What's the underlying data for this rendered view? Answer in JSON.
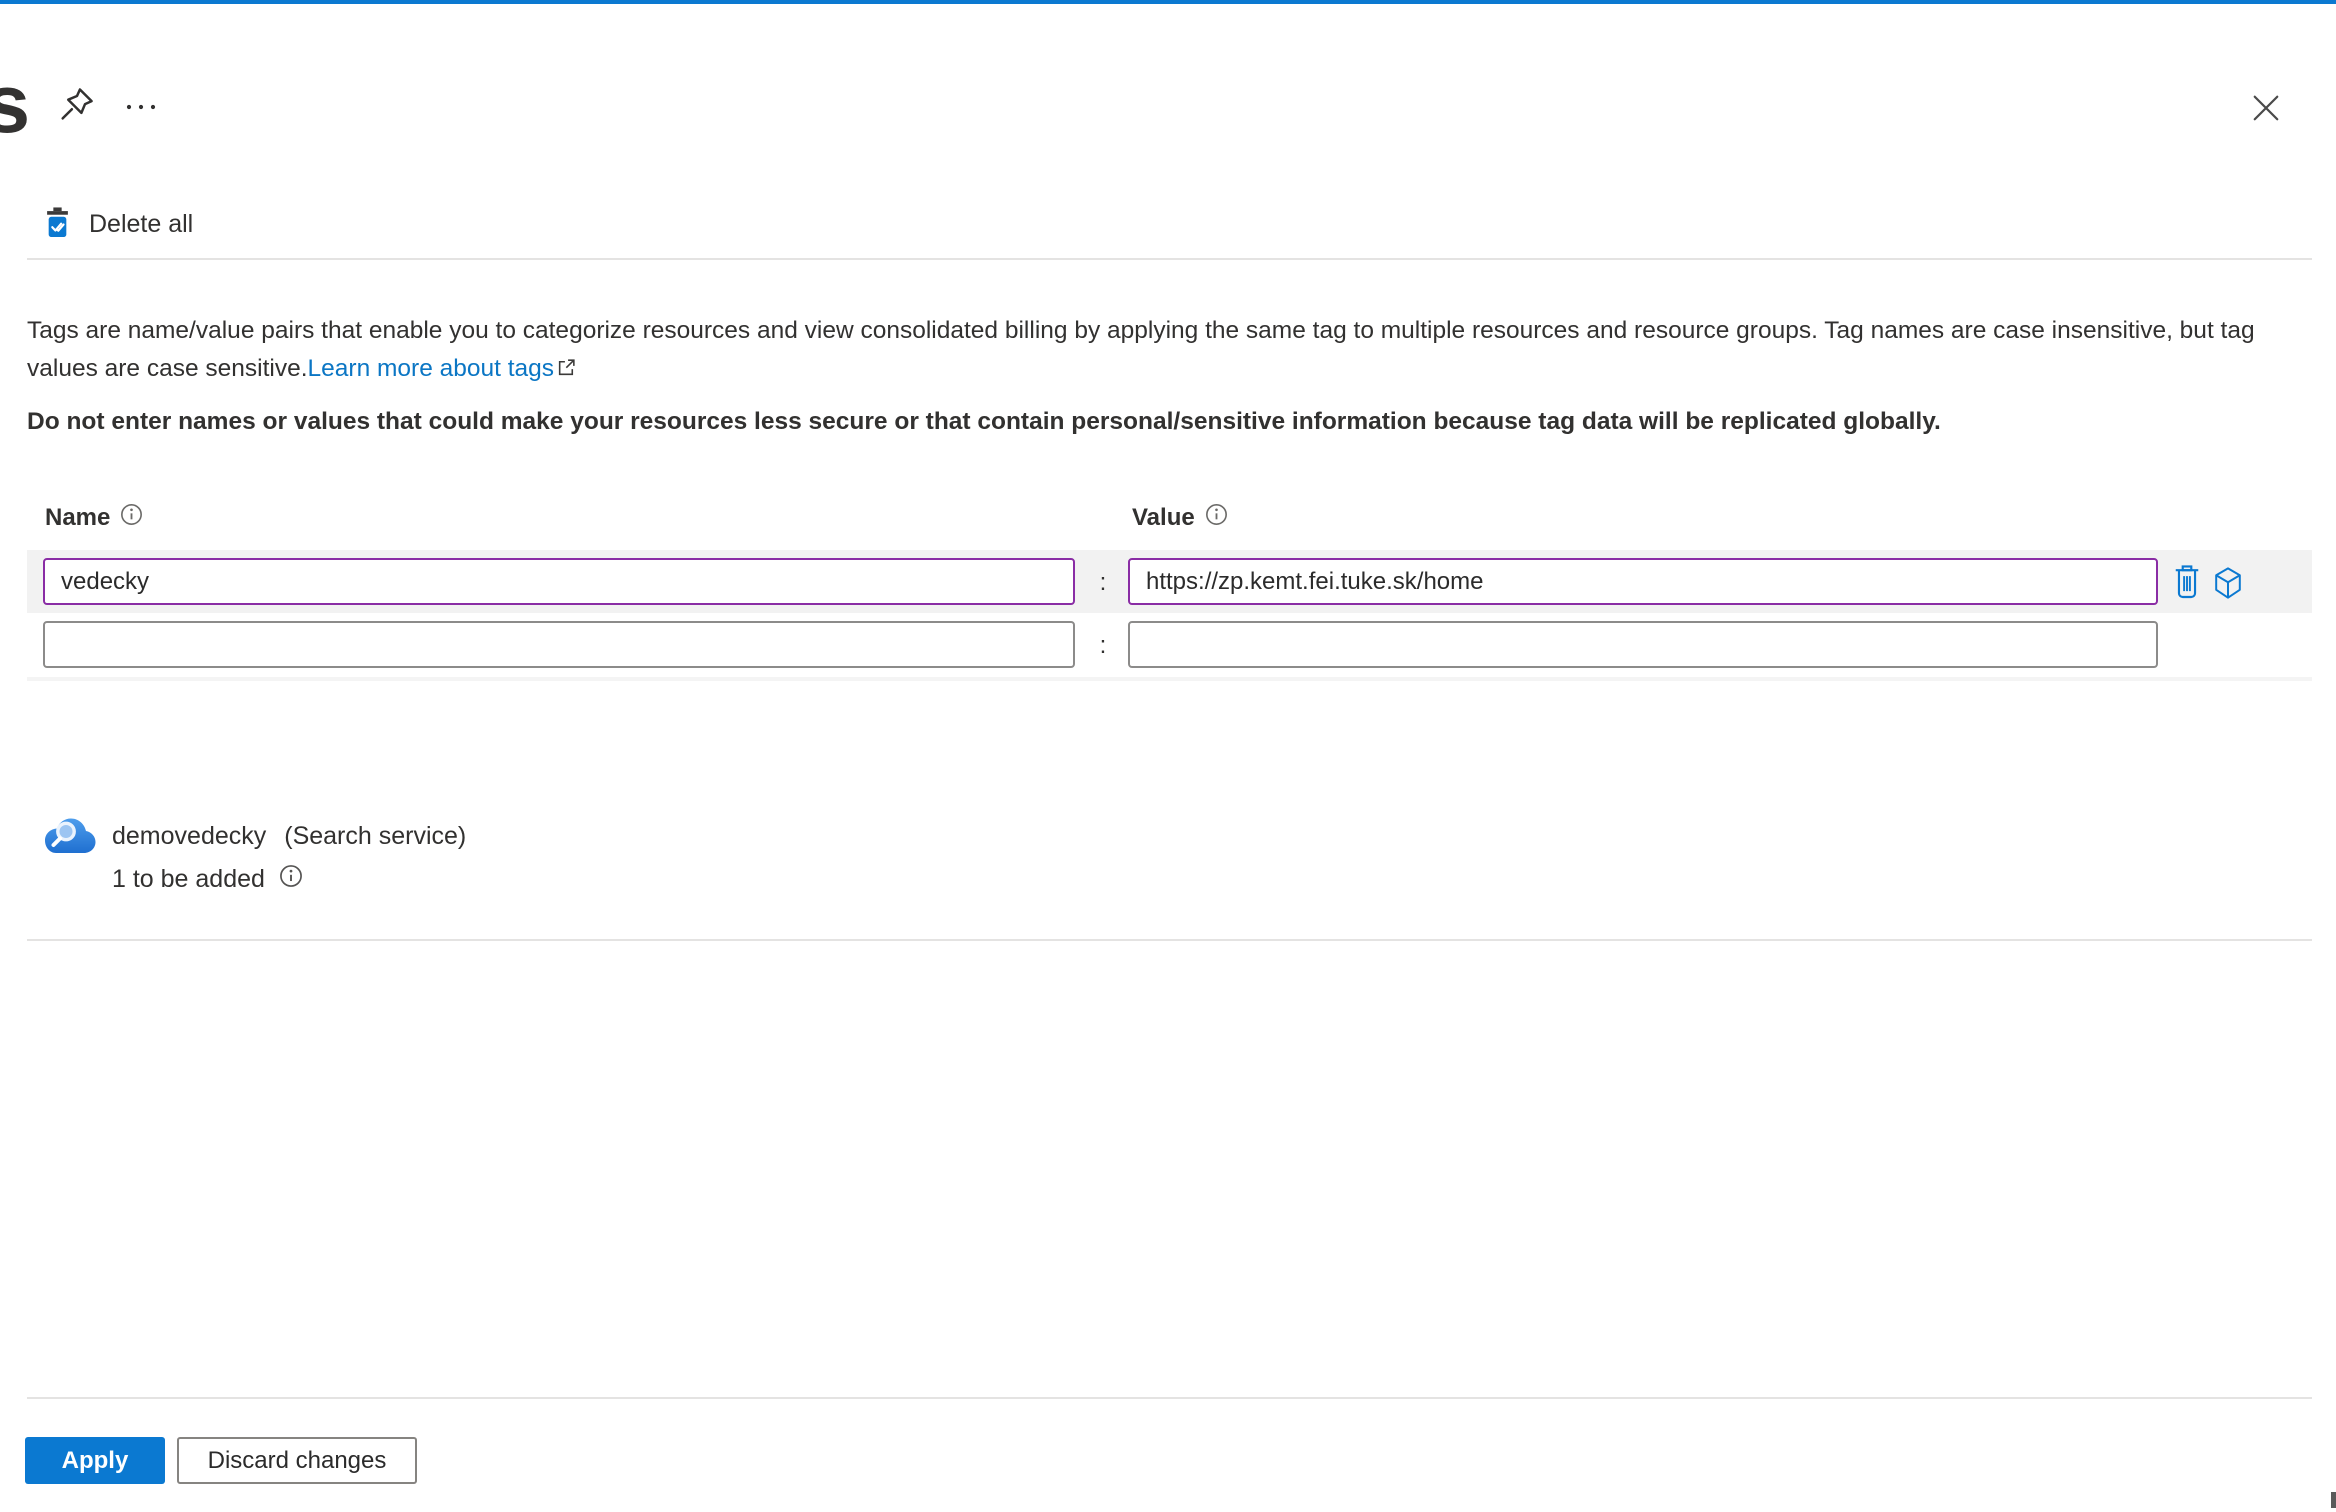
{
  "titlebar": {
    "title_partial": "s"
  },
  "toolbar": {
    "delete_all_label": "Delete all"
  },
  "description": {
    "text": "Tags are name/value pairs that enable you to categorize resources and view consolidated billing by applying the same tag to multiple resources and resource groups. Tag names are case insensitive, but tag values are case sensitive.",
    "link_label": "Learn more about tags",
    "warning": "Do not enter names or values that could make your resources less secure or that contain personal/sensitive information because tag data will be replicated globally."
  },
  "grid": {
    "name_header": "Name",
    "value_header": "Value",
    "separator": ":",
    "rows": [
      {
        "name": "vedecky",
        "value": "https://zp.kemt.fei.tuke.sk/home",
        "state": "modified"
      },
      {
        "name": "",
        "value": "",
        "state": "empty"
      }
    ]
  },
  "resource": {
    "name": "demovedecky",
    "type": "(Search service)",
    "status": "1 to be added"
  },
  "footer": {
    "apply_label": "Apply",
    "discard_label": "Discard changes"
  },
  "icons": {
    "top_left": "pin-icon, more-icon (ellipsis)",
    "top_right": "close-icon",
    "toolbar": "delete-all-icon (blue trash with double check)",
    "row_actions": "trash-icon, cube-icon",
    "resource": "search-service-cloud-icon",
    "info": "info-circle-icon",
    "link": "external-link-icon"
  },
  "colors": {
    "accent": "#0078d4",
    "top_line": "#0b79d1",
    "modified_field_border": "#8a2da5",
    "link": "#0b76c4",
    "row_highlight": "#f2f2f2"
  }
}
